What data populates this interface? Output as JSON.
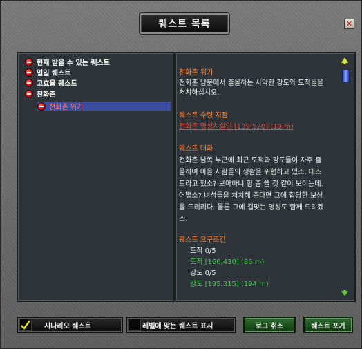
{
  "window": {
    "title": "퀘스트 목록",
    "close_icon": "close-icon"
  },
  "quest_tree": [
    {
      "label": "현재 받을 수 있는 퀘스트",
      "expanded": true
    },
    {
      "label": "일일 퀘스트",
      "expanded": true
    },
    {
      "label": "고효율 퀘스트",
      "expanded": true
    },
    {
      "label": "천화촌",
      "expanded": true
    },
    {
      "label": "천화촌 위기",
      "expanded": true,
      "selected": true
    }
  ],
  "detail": {
    "title_header": "천화촌 위기",
    "title_desc": "천화촌 남문에서 출몰하는 사악한 강도와 도적들을",
    "title_desc2": "처치하십시오.",
    "location_header": "퀘스트 수령 지점",
    "location_link": "천화촌 명성치설인 [139,520] (10 m)",
    "dialog_header": "퀘스트 대화",
    "dialog_lines": [
      "천화촌 남쪽 부근에 최근 도적과 강도들이 자주 출",
      "몰하여 마을 사람들의 생활을 위협하고 있소. 테스",
      "트라고 했소? 보아하니 힘 좀 쓸 것 같이 보이는데.",
      "어떻소? 녀석들을 처치해 준다면 그에 합당한 보상",
      "을 드리리다. 물론 그에 걸맞는 명성도 함께 드리겠",
      "소."
    ],
    "requirements_header": "퀘스트 요구조건",
    "requirements": [
      {
        "name": "도적 0/5",
        "link": "도적 [160,430] (86 m)"
      },
      {
        "name": "강도 0/5",
        "link": "강도 [195,315] (194 m)"
      }
    ]
  },
  "bottom": {
    "scenario_label": "시나리오 퀘스트",
    "scenario_checked": true,
    "level_label": "레벨에 맞는 퀘스트 표시",
    "level_checked": false,
    "cancel_log_label": "로그 취소",
    "abandon_label": "퀘스트 포기"
  },
  "colors": {
    "header": "#ff8a40",
    "location_link": "#e34a3a",
    "target_link": "#3cd04a",
    "selected_bg": "#3a4da0"
  }
}
